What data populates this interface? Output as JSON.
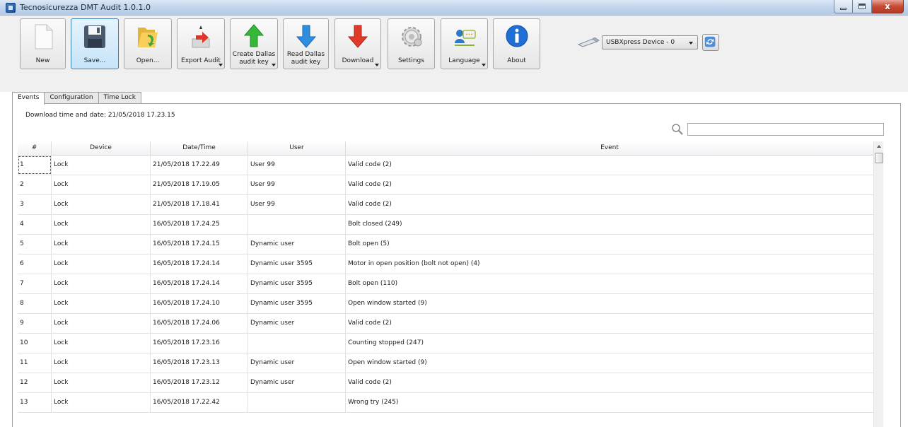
{
  "window": {
    "title": "Tecnosicurezza DMT Audit 1.0.1.0",
    "controls": {
      "minimize_icon": "minimize-icon",
      "maximize_icon": "maximize-icon",
      "close_icon": "close-icon",
      "close_glyph": "x"
    }
  },
  "toolbar": {
    "new_label": "New",
    "save_label": "Save...",
    "open_label": "Open...",
    "export_label": "Export Audit",
    "create_dallas_line1": "Create Dallas",
    "create_dallas_line2": "audit key",
    "read_dallas_line1": "Read Dallas",
    "read_dallas_line2": "audit key",
    "download_label": "Download",
    "settings_label": "Settings",
    "language_label": "Language",
    "about_label": "About",
    "device_selected": "USBXpress Device - 0"
  },
  "tabs": [
    {
      "label": "Events",
      "selected": true
    },
    {
      "label": "Configuration",
      "selected": false
    },
    {
      "label": "Time Lock",
      "selected": false
    }
  ],
  "events": {
    "download_info": "Download time and date: 21/05/2018 17.23.15",
    "search": {
      "value": "",
      "placeholder": ""
    },
    "columns": [
      "#",
      "Device",
      "Date/Time",
      "User",
      "Event"
    ],
    "rows": [
      [
        "1",
        "Lock",
        "21/05/2018 17.22.49",
        "User 99",
        "Valid code (2)"
      ],
      [
        "2",
        "Lock",
        "21/05/2018 17.19.05",
        "User 99",
        "Valid code (2)"
      ],
      [
        "3",
        "Lock",
        "21/05/2018 17.18.41",
        "User 99",
        "Valid code (2)"
      ],
      [
        "4",
        "Lock",
        "16/05/2018 17.24.25",
        "",
        "Bolt closed (249)"
      ],
      [
        "5",
        "Lock",
        "16/05/2018 17.24.15",
        "Dynamic user",
        "Bolt open (5)"
      ],
      [
        "6",
        "Lock",
        "16/05/2018 17.24.14",
        "Dynamic user 3595",
        "Motor in open position (bolt not open) (4)"
      ],
      [
        "7",
        "Lock",
        "16/05/2018 17.24.14",
        "Dynamic user 3595",
        "Bolt open (110)"
      ],
      [
        "8",
        "Lock",
        "16/05/2018 17.24.10",
        "Dynamic user 3595",
        "Open window started (9)"
      ],
      [
        "9",
        "Lock",
        "16/05/2018 17.24.06",
        "Dynamic user",
        "Valid code (2)"
      ],
      [
        "10",
        "Lock",
        "16/05/2018 17.23.16",
        "",
        "Counting stopped (247)"
      ],
      [
        "11",
        "Lock",
        "16/05/2018 17.23.13",
        "Dynamic user",
        "Open window started (9)"
      ],
      [
        "12",
        "Lock",
        "16/05/2018 17.23.12",
        "Dynamic user",
        "Valid code (2)"
      ],
      [
        "13",
        "Lock",
        "16/05/2018 17.22.42",
        "",
        "Wrong try (245)"
      ]
    ]
  },
  "colors": {
    "titlebar": "#c3d6ec",
    "active_button": "#c6e4f9",
    "green_arrow": "#35b83a",
    "blue_arrow": "#2f8de0",
    "red_arrow": "#e23a2a",
    "info_blue": "#1f6fd6"
  }
}
